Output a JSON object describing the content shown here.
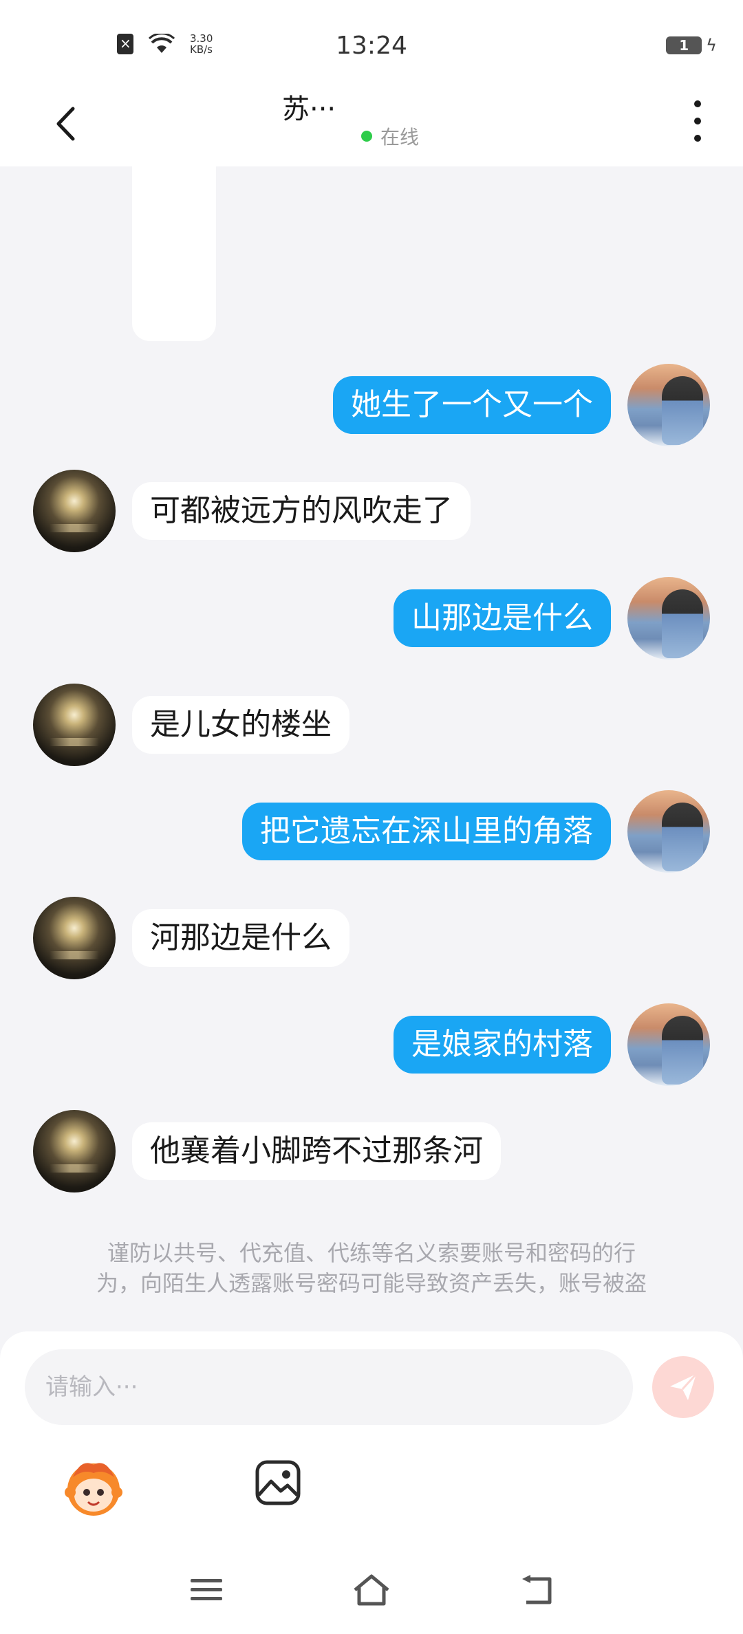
{
  "status_bar": {
    "time": "13:24",
    "net_speed_value": "3.30",
    "net_speed_unit": "KB/s",
    "battery_level": "1",
    "icons": [
      "sim-off-icon",
      "wifi-icon",
      "battery-icon",
      "charging-icon"
    ]
  },
  "header": {
    "title": "苏···",
    "status": "在线",
    "status_color": "#2ecc4a",
    "icons": [
      "back-arrow-icon",
      "more-vertical-icon"
    ]
  },
  "messages": [
    {
      "side": "right",
      "text": "她生了一个又一个"
    },
    {
      "side": "left",
      "text": "可都被远方的风吹走了"
    },
    {
      "side": "right",
      "text": "山那边是什么"
    },
    {
      "side": "left",
      "text": "是儿女的楼坐"
    },
    {
      "side": "right",
      "text": "把它遗忘在深山里的角落"
    },
    {
      "side": "left",
      "text": "河那边是什么"
    },
    {
      "side": "right",
      "text": "是娘家的村落"
    },
    {
      "side": "left",
      "text": "他襄着小脚跨不过那条河"
    }
  ],
  "notice": {
    "line1": "谨防以共号、代充值、代练等名义索要账号和密码的行",
    "line2": "为，向陌生人透露账号密码可能导致资产丢失，账号被盗"
  },
  "composer": {
    "placeholder": "请输入···",
    "send_color": "#fdd8d4",
    "icons": [
      "send-icon",
      "sticker-icon",
      "image-icon"
    ]
  },
  "nav_bar": {
    "icons": [
      "menu-icon",
      "home-icon",
      "back-icon"
    ]
  },
  "colors": {
    "outgoing_bubble": "#1aa6f4",
    "incoming_bubble": "#ffffff",
    "background": "#f4f4f7"
  }
}
